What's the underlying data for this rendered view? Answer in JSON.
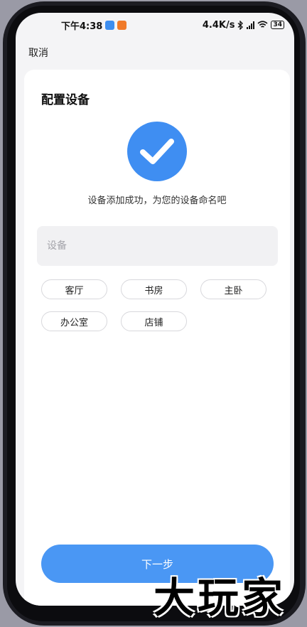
{
  "status_bar": {
    "time": "下午4:38",
    "speed": "4.4K/s",
    "battery": "34"
  },
  "header": {
    "cancel_label": "取消"
  },
  "card": {
    "title": "配置设备",
    "success_text": "设备添加成功，为您的设备命名吧",
    "name_input": {
      "placeholder": "设备",
      "value": ""
    },
    "suggestions": [
      "客厅",
      "书房",
      "主卧",
      "办公室",
      "店铺"
    ]
  },
  "footer": {
    "next_label": "下一步"
  },
  "watermark": {
    "text": "大玩家"
  },
  "colors": {
    "accent": "#4a97f4",
    "success_icon": "#3f8ef2"
  },
  "icons": {
    "success": "checkmark-icon",
    "bluetooth": "bluetooth-icon",
    "signal": "signal-icon",
    "wifi": "wifi-icon"
  }
}
